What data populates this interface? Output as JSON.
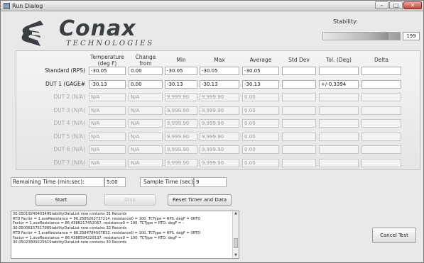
{
  "window": {
    "title": "Run Dialog",
    "min": "–",
    "max": "□",
    "close": "✕"
  },
  "logo": {
    "word": "Conax",
    "sub": "TECHNOLOGIES"
  },
  "stability": {
    "label": "Stability:",
    "value": "199",
    "fill_fraction": 0.85
  },
  "table": {
    "headers": [
      "Temperature (deg F)",
      "Change from Previous",
      "Min",
      "Max",
      "Average",
      "Std Dev",
      "Tol. (Deg)",
      "Delta"
    ],
    "rows": [
      {
        "label": "Standard (RPS)",
        "dim": false,
        "cells": [
          "-30.05",
          "0.00",
          "-30.05",
          "-30.05",
          "-30.05",
          "",
          "",
          ""
        ]
      },
      {
        "label": "DUT 1 (GAGE#",
        "dim": false,
        "cells": [
          "-30.13",
          "0.00",
          "-30.13",
          "-30.13",
          "-30.13",
          "",
          "+/-0.3394",
          ""
        ]
      },
      {
        "label": "DUT 2 (N/A)",
        "dim": true,
        "cells": [
          "N/A",
          "N/A",
          "9,999.90",
          "9,999.90",
          "0.00",
          "",
          "",
          ""
        ]
      },
      {
        "label": "DUT 3 (N/A)",
        "dim": true,
        "cells": [
          "N/A",
          "N/A",
          "9,999.90",
          "9,999.90",
          "0.00",
          "",
          "",
          ""
        ]
      },
      {
        "label": "DUT 4 (N/A)",
        "dim": true,
        "cells": [
          "N/A",
          "N/A",
          "9,999.90",
          "9,999.90",
          "0.00",
          "",
          "",
          ""
        ]
      },
      {
        "label": "DUT 5 (N/A)",
        "dim": true,
        "cells": [
          "N/A",
          "N/A",
          "9,999.90",
          "9,999.90",
          "0.00",
          "",
          "",
          ""
        ]
      },
      {
        "label": "DUT 6 (N/A)",
        "dim": true,
        "cells": [
          "N/A",
          "N/A",
          "9,999.90",
          "9,999.90",
          "0.00",
          "",
          "",
          ""
        ]
      },
      {
        "label": "DUT 7 (N/A)",
        "dim": true,
        "cells": [
          "N/A",
          "N/A",
          "9,999.90",
          "9,999.90",
          "0.00",
          "",
          "",
          ""
        ]
      }
    ]
  },
  "remaining": {
    "label": "Remaining Time (min:sec):",
    "value": "5:00"
  },
  "sample": {
    "label": "Sample Time (sec):",
    "value": "9"
  },
  "buttons": {
    "start": "Start",
    "stop": "Stop",
    "reset": "Reset Timer and Data",
    "cancel": "Cancel Test"
  },
  "log": {
    "lines": [
      "30.0501924040349StabilityDataList now contains 31 Records",
      "RTD Factor = 1.aveResistance = 86.2585262737214. resistance0 = 100. TCType = RPS. degF = 0RTD",
      "Factor = 1.aveResistance = 86.4386217452067. resistance0 = 100. TCType = RTD. degF = -",
      "30.0500815751798StabilityDataList now contains 32 Records",
      "RTD Factor = 1.aveResistance = 86.2584784507832. resistance0 = 100. TCType = RPS. degF = 0RTD",
      "Factor = 1.aveResistance = 86.4388594229137. resistance0 = 100. TCType = RTD. degF = -",
      "30.0502380922561StabilityDataList now contains 33 Records"
    ]
  }
}
